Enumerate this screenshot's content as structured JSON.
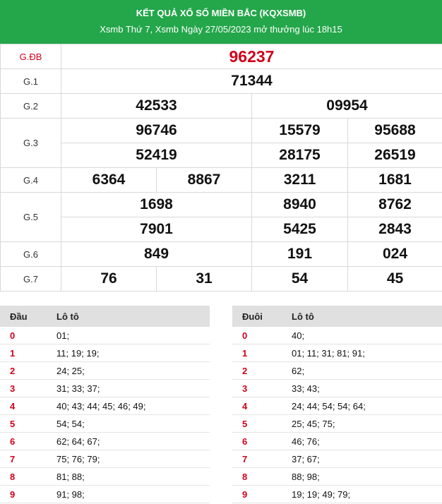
{
  "header": {
    "title": "KẾT QUẢ XỔ SỐ MIỀN BẮC (KQXSMB)",
    "subtitle": "Xsmb Thứ 7, Xsmb Ngày 27/05/2023 mở thưởng lúc 18h15"
  },
  "prizes": {
    "gdb": {
      "label": "G.ĐB",
      "numbers": [
        "96237"
      ]
    },
    "g1": {
      "label": "G.1",
      "numbers": [
        "71344"
      ]
    },
    "g2": {
      "label": "G.2",
      "numbers": [
        "42533",
        "09954"
      ]
    },
    "g3": {
      "label": "G.3",
      "numbers": [
        "96746",
        "15579",
        "95688",
        "52419",
        "28175",
        "26519"
      ]
    },
    "g4": {
      "label": "G.4",
      "numbers": [
        "6364",
        "8867",
        "3211",
        "1681"
      ]
    },
    "g5": {
      "label": "G.5",
      "numbers": [
        "1698",
        "8940",
        "8762",
        "7901",
        "5425",
        "2843"
      ]
    },
    "g6": {
      "label": "G.6",
      "numbers": [
        "849",
        "191",
        "024"
      ]
    },
    "g7": {
      "label": "G.7",
      "numbers": [
        "76",
        "31",
        "54",
        "45"
      ]
    }
  },
  "loto_head": {
    "col1": "Đầu",
    "col2": "Lô tô",
    "rows": [
      {
        "k": "0",
        "v": "01;"
      },
      {
        "k": "1",
        "v": "11; 19; 19;"
      },
      {
        "k": "2",
        "v": "24; 25;"
      },
      {
        "k": "3",
        "v": "31; 33; 37;"
      },
      {
        "k": "4",
        "v": "40; 43; 44; 45; 46; 49;"
      },
      {
        "k": "5",
        "v": "54; 54;"
      },
      {
        "k": "6",
        "v": "62; 64; 67;"
      },
      {
        "k": "7",
        "v": "75; 76; 79;"
      },
      {
        "k": "8",
        "v": "81; 88;"
      },
      {
        "k": "9",
        "v": "91; 98;"
      }
    ]
  },
  "loto_tail": {
    "col1": "Đuôi",
    "col2": "Lô tô",
    "rows": [
      {
        "k": "0",
        "v": "40;"
      },
      {
        "k": "1",
        "v": "01; 11; 31; 81; 91;"
      },
      {
        "k": "2",
        "v": "62;"
      },
      {
        "k": "3",
        "v": "33; 43;"
      },
      {
        "k": "4",
        "v": "24; 44; 54; 54; 64;"
      },
      {
        "k": "5",
        "v": "25; 45; 75;"
      },
      {
        "k": "6",
        "v": "46; 76;"
      },
      {
        "k": "7",
        "v": "37; 67;"
      },
      {
        "k": "8",
        "v": "88; 98;"
      },
      {
        "k": "9",
        "v": "19; 19; 49; 79;"
      }
    ]
  }
}
